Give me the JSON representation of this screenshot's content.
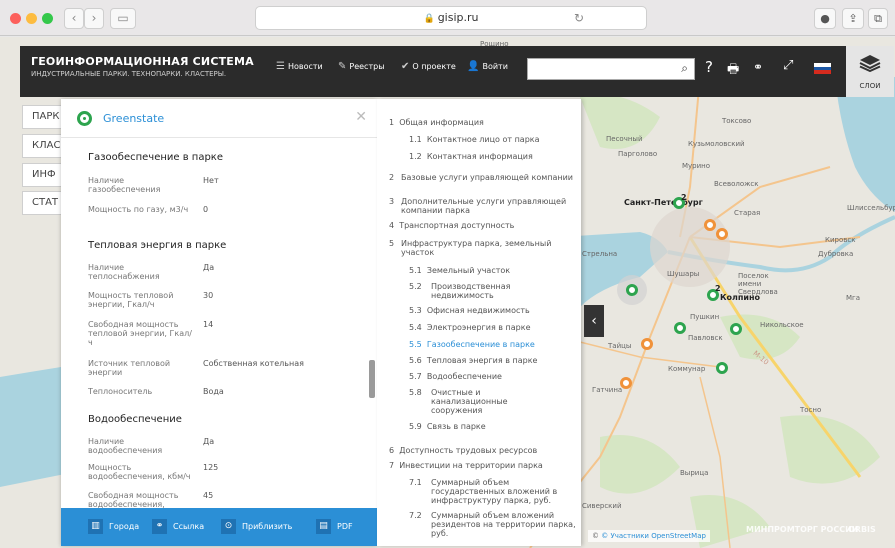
{
  "browser": {
    "url": "gisip.ru"
  },
  "header": {
    "title": "ГЕОИНФОРМАЦИОННАЯ СИСТЕМА",
    "subtitle": "ИНДУСТРИАЛЬНЫЕ ПАРКИ. ТЕХНОПАРКИ. КЛАСТЕРЫ.",
    "nav": [
      {
        "label": "Новости",
        "icon": "news-icon"
      },
      {
        "label": "Реестры",
        "icon": "registry-icon"
      },
      {
        "label": "О проекте",
        "icon": "check-icon"
      },
      {
        "label": "Войти",
        "icon": "user-icon"
      }
    ],
    "search_placeholder": "",
    "layers_label": "СЛОИ"
  },
  "left_tabs": [
    "ПАРК",
    "КЛАС",
    "ИНФ",
    "СТАТ"
  ],
  "panel": {
    "name": "Greenstate",
    "sections": [
      {
        "title": "Газообеспечение в парке",
        "fields": [
          {
            "label": "Наличие газообеспечения",
            "value": "Нет"
          },
          {
            "label": "Мощность по газу, м3/ч",
            "value": "0"
          }
        ]
      },
      {
        "title": "Тепловая энергия в парке",
        "fields": [
          {
            "label": "Наличие теплоснабжения",
            "value": "Да"
          },
          {
            "label": "Мощность тепловой энергии, Гкал/ч",
            "value": "30"
          },
          {
            "label": "Свободная мощность тепловой энергии, Гкал/ч",
            "value": "14"
          },
          {
            "label": "Источник тепловой энергии",
            "value": "Собственная котельная"
          },
          {
            "label": "Теплоноситель",
            "value": "Вода"
          }
        ]
      },
      {
        "title": "Водообеспечение",
        "fields": [
          {
            "label": "Наличие водообеспечения",
            "value": "Да"
          },
          {
            "label": "Мощность водообеспечения, кбм/ч",
            "value": "125"
          },
          {
            "label": "Свободная мощность водообеспечения,",
            "value": "45"
          }
        ]
      }
    ],
    "footer": [
      {
        "label": "Города",
        "icon": "book-icon"
      },
      {
        "label": "Ссылка",
        "icon": "link-icon"
      },
      {
        "label": "Приблизить",
        "icon": "target-icon"
      },
      {
        "label": "PDF",
        "icon": "pdf-icon"
      }
    ]
  },
  "toc": [
    {
      "num": "1",
      "label": "Общая информация"
    },
    {
      "num": "1.1",
      "label": "Контактное лицо от парка"
    },
    {
      "num": "1.2",
      "label": "Контактная информация"
    },
    {
      "num": "2",
      "label": "Базовые услуги управляющей компании"
    },
    {
      "num": "3",
      "label": "Дополнительные услуги управляющей компании парка"
    },
    {
      "num": "4",
      "label": "Транспортная доступность"
    },
    {
      "num": "5",
      "label": "Инфраструктура парка, земельный участок"
    },
    {
      "num": "5.1",
      "label": "Земельный участок"
    },
    {
      "num": "5.2",
      "label": "Производственная недвижимость"
    },
    {
      "num": "5.3",
      "label": "Офисная недвижимость"
    },
    {
      "num": "5.4",
      "label": "Электроэнергия в парке"
    },
    {
      "num": "5.5",
      "label": "Газообеспечение в парке"
    },
    {
      "num": "5.6",
      "label": "Тепловая энергия в парке"
    },
    {
      "num": "5.7",
      "label": "Водообеспечение"
    },
    {
      "num": "5.8",
      "label": "Очистные и канализационные сооружения"
    },
    {
      "num": "5.9",
      "label": "Связь в парке"
    },
    {
      "num": "6",
      "label": "Доступность трудовых ресурсов"
    },
    {
      "num": "7",
      "label": "Инвестиции на территории парка"
    },
    {
      "num": "7.1",
      "label": "Суммарный объем государственных вложений в инфраструктуру парка, руб."
    },
    {
      "num": "7.2",
      "label": "Суммарный объем вложений резидентов на территории парка, руб."
    }
  ],
  "map": {
    "labels": [
      "Рощино",
      "Токсово",
      "Песочный",
      "Кузьмоловский",
      "Парголово",
      "Мурино",
      "Всеволожск",
      "Санкт-Петербург",
      "Старая",
      "Шлиссельбург",
      "Кировск",
      "Дубровка",
      "Стрельна",
      "Шушары",
      "Поселок имени Свердлова",
      "Колпино",
      "Мга",
      "Пушкин",
      "Павловск",
      "Никольское",
      "Тайцы",
      "Коммунар",
      "Гатчина",
      "Тосно",
      "Вырица",
      "Сиверский",
      "М-10"
    ],
    "cluster_counts": [
      "2",
      "2"
    ],
    "attribution": "© Участники OpenStreetMap",
    "watermark1": "МИНПРОМТОРГ РОССИИ",
    "watermark2": "ORBIS"
  }
}
